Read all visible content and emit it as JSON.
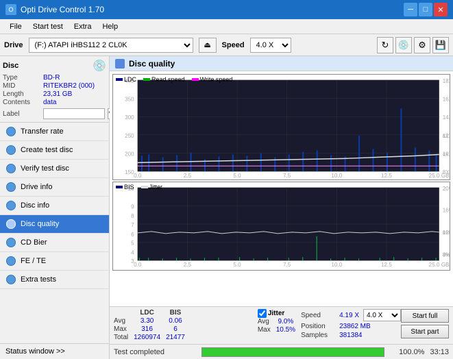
{
  "titleBar": {
    "title": "Opti Drive Control 1.70",
    "icon": "O"
  },
  "menuBar": {
    "items": [
      "File",
      "Start test",
      "Extra",
      "Help"
    ]
  },
  "driveBar": {
    "driveLabel": "Drive",
    "driveValue": "(F:) ATAPI iHBS112  2 CL0K",
    "speedLabel": "Speed",
    "speedValue": "4.0 X"
  },
  "disc": {
    "title": "Disc",
    "typeLabel": "Type",
    "typeValue": "BD-R",
    "midLabel": "MID",
    "midValue": "RITEKBR2 (000)",
    "lengthLabel": "Length",
    "lengthValue": "23,31 GB",
    "contentsLabel": "Contents",
    "contentsValue": "data",
    "labelLabel": "Label"
  },
  "sidebarItems": [
    {
      "id": "transfer-rate",
      "label": "Transfer rate",
      "active": false
    },
    {
      "id": "create-test-disc",
      "label": "Create test disc",
      "active": false
    },
    {
      "id": "verify-test-disc",
      "label": "Verify test disc",
      "active": false
    },
    {
      "id": "drive-info",
      "label": "Drive info",
      "active": false
    },
    {
      "id": "disc-info",
      "label": "Disc info",
      "active": false
    },
    {
      "id": "disc-quality",
      "label": "Disc quality",
      "active": true
    },
    {
      "id": "cd-bier",
      "label": "CD Bier",
      "active": false
    },
    {
      "id": "fe-te",
      "label": "FE / TE",
      "active": false
    },
    {
      "id": "extra-tests",
      "label": "Extra tests",
      "active": false
    }
  ],
  "statusWindow": "Status window >>",
  "discQuality": {
    "title": "Disc quality"
  },
  "legend1": {
    "ldc": "LDC",
    "readSpeed": "Read speed",
    "writeSpeed": "Write speed"
  },
  "legend2": {
    "bis": "BIS",
    "jitter": "Jitter"
  },
  "stats": {
    "headers": [
      "",
      "LDC",
      "BIS"
    ],
    "rows": [
      {
        "label": "Avg",
        "ldc": "3.30",
        "bis": "0.06"
      },
      {
        "label": "Max",
        "ldc": "316",
        "bis": "6"
      },
      {
        "label": "Total",
        "ldc": "1260974",
        "bis": "21477"
      }
    ],
    "jitterHeader": "Jitter",
    "jitterRows": [
      {
        "label": "Avg",
        "val": "9.0%"
      },
      {
        "label": "Max",
        "val": "10.5%"
      }
    ],
    "speedLabel": "Speed",
    "speedValue": "4.19 X",
    "speedSelectValue": "4.0 X",
    "positionLabel": "Position",
    "positionValue": "23862 MB",
    "samplesLabel": "Samples",
    "samplesValue": "381384",
    "btnFull": "Start full",
    "btnPart": "Start part"
  },
  "bottomBar": {
    "statusText": "Test completed",
    "progressPercent": 100,
    "progressText": "100.0%",
    "time": "33:13"
  }
}
